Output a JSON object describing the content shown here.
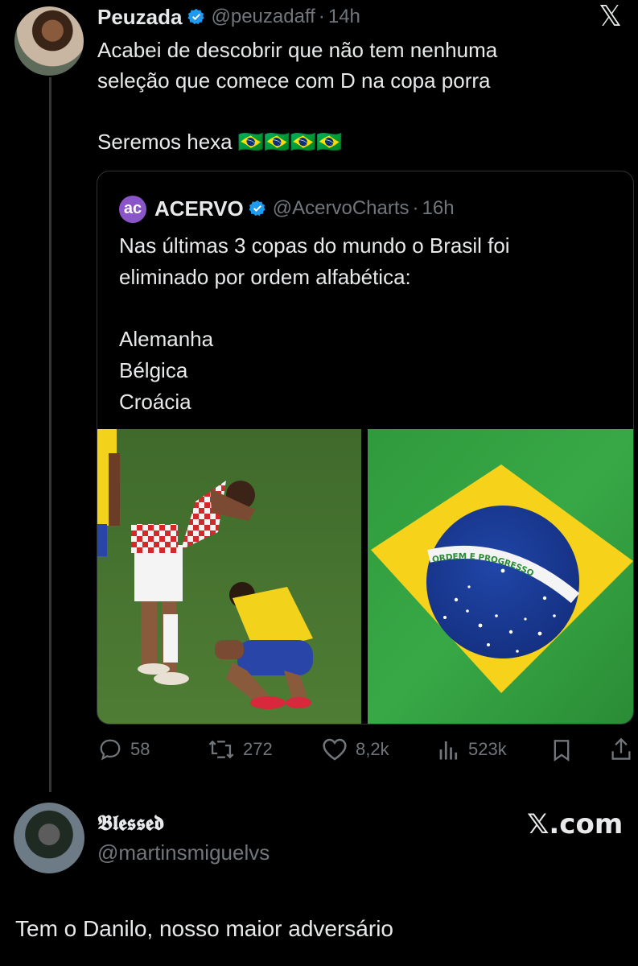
{
  "main_tweet": {
    "display_name": "Peuzada",
    "handle": "@peuzadaff",
    "separator": "·",
    "time": "14h",
    "text_line1": "Acabei de descobrir que não tem nenhuma",
    "text_line2": "seleção que comece com D na copa porra",
    "text_line3": "Seremos hexa 🇧🇷🇧🇷🇧🇷🇧🇷",
    "x_logo": "𝕏"
  },
  "quoted_tweet": {
    "avatar_text": "ac",
    "display_name": "ACERVO",
    "handle": "@AcervoCharts",
    "separator": "·",
    "time": "16h",
    "text_line1": "Nas últimas 3 copas do mundo o Brasil foi",
    "text_line2": "eliminado por ordem alfabética:",
    "list": [
      "Alemanha",
      "Bélgica",
      "Croácia"
    ],
    "flag_motto": "ORDEM E PROGRESSO"
  },
  "actions": {
    "replies": "58",
    "retweets": "272",
    "likes": "8,2k",
    "views": "523k"
  },
  "reply": {
    "display_name": "𝕭𝖑𝖊𝖘𝖘𝖊𝖉",
    "handle": "@martinsmiguelvs",
    "watermark": "𝕏.com",
    "text": "Tem o Danilo, nosso maior adversário"
  },
  "colors": {
    "background": "#000000",
    "text": "#e7e9ea",
    "muted": "#71767b",
    "verified": "#1d9bf0",
    "flag_green": "#2f9a3c",
    "flag_yellow": "#f6d21a",
    "flag_blue": "#17348f"
  }
}
